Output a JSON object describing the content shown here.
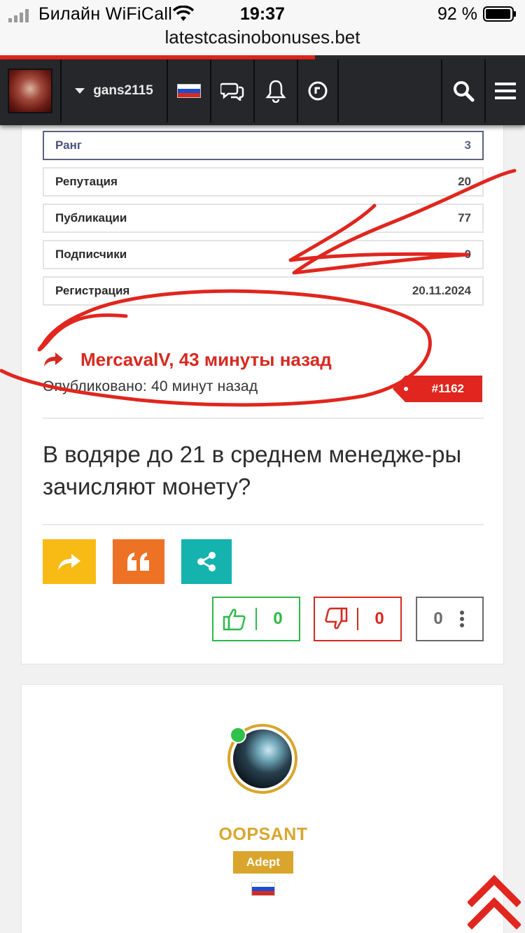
{
  "status_bar": {
    "carrier": "Билайн WiFiCall",
    "time": "19:37",
    "battery": "92 %"
  },
  "browser": {
    "url": "latestcasinobonuses.bet",
    "load_progress": 0.6
  },
  "header": {
    "username": "gans2115",
    "icons": [
      "logo",
      "caret-down-icon",
      "russia-flag-icon",
      "chat-icon",
      "bell-icon",
      "clock-icon",
      "search-icon",
      "menu-icon"
    ]
  },
  "stats": [
    {
      "label": "Ранг",
      "value": "3"
    },
    {
      "label": "Репутация",
      "value": "20"
    },
    {
      "label": "Публикации",
      "value": "77"
    },
    {
      "label": "Подписчики",
      "value": "0"
    },
    {
      "label": "Регистрация",
      "value": "20.11.2024"
    }
  ],
  "post": {
    "reply_to": "MercavalV, 43 минуты назад",
    "published": "Опубликовано: 40 минут назад",
    "number": "#1162",
    "text": "В водяре до 21 в среднем менедже-ры зачисляют монету?"
  },
  "actions": {
    "likes": "0",
    "dislikes": "0",
    "score": "0"
  },
  "next_post": {
    "author": "OOPSANT",
    "rank": "Adept"
  },
  "colors": {
    "accent_red": "#e0261e",
    "like_green": "#2fb84a",
    "gold": "#d9a52c",
    "reply_yellow": "#f8bb15",
    "quote_orange": "#ee7226",
    "share_teal": "#14b3ae"
  }
}
